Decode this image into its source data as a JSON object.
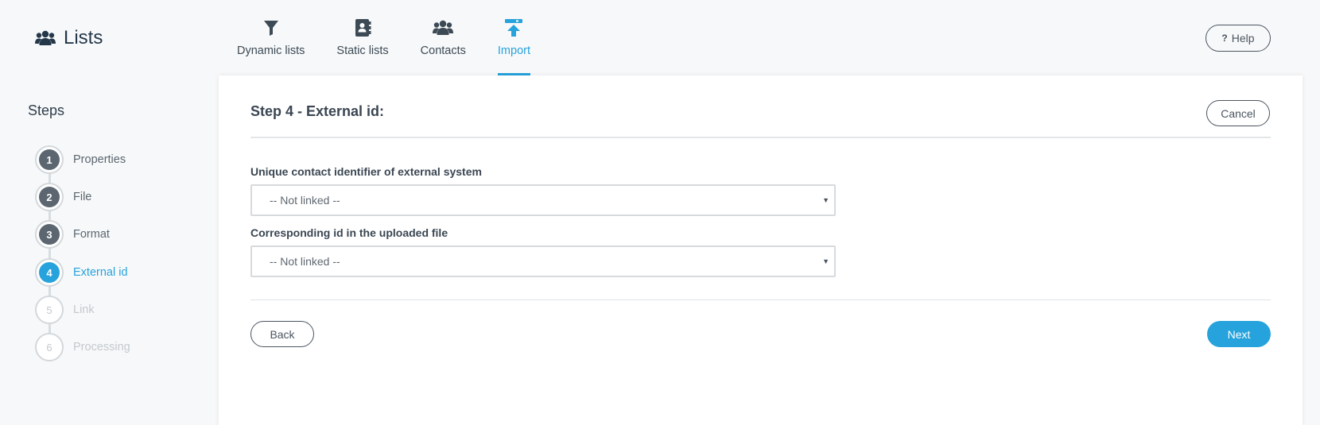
{
  "header": {
    "title": "Lists",
    "icon": "users-icon",
    "help_label": "Help",
    "help_prefix": "?"
  },
  "nav": {
    "items": [
      {
        "label": "Dynamic lists",
        "icon": "filter-icon"
      },
      {
        "label": "Static lists",
        "icon": "address-book-icon"
      },
      {
        "label": "Contacts",
        "icon": "users-icon"
      },
      {
        "label": "Import",
        "icon": "upload-icon",
        "active": true
      }
    ]
  },
  "sidebar": {
    "title": "Steps",
    "steps": [
      {
        "number": "1",
        "label": "Properties",
        "state": "done"
      },
      {
        "number": "2",
        "label": "File",
        "state": "done"
      },
      {
        "number": "3",
        "label": "Format",
        "state": "done"
      },
      {
        "number": "4",
        "label": "External id",
        "state": "active"
      },
      {
        "number": "5",
        "label": "Link",
        "state": "pending"
      },
      {
        "number": "6",
        "label": "Processing",
        "state": "pending"
      }
    ]
  },
  "main": {
    "title": "Step 4 - External id:",
    "cancel_label": "Cancel",
    "field1": {
      "label": "Unique contact identifier of external system",
      "value": "-- Not linked --"
    },
    "field2": {
      "label": "Corresponding id in the uploaded file",
      "value": "-- Not linked --"
    },
    "back_label": "Back",
    "next_label": "Next"
  },
  "colors": {
    "accent": "#26a3dc",
    "text_dark": "#24384a",
    "step_done": "#5b6670",
    "step_pending": "#c3c9ce"
  }
}
